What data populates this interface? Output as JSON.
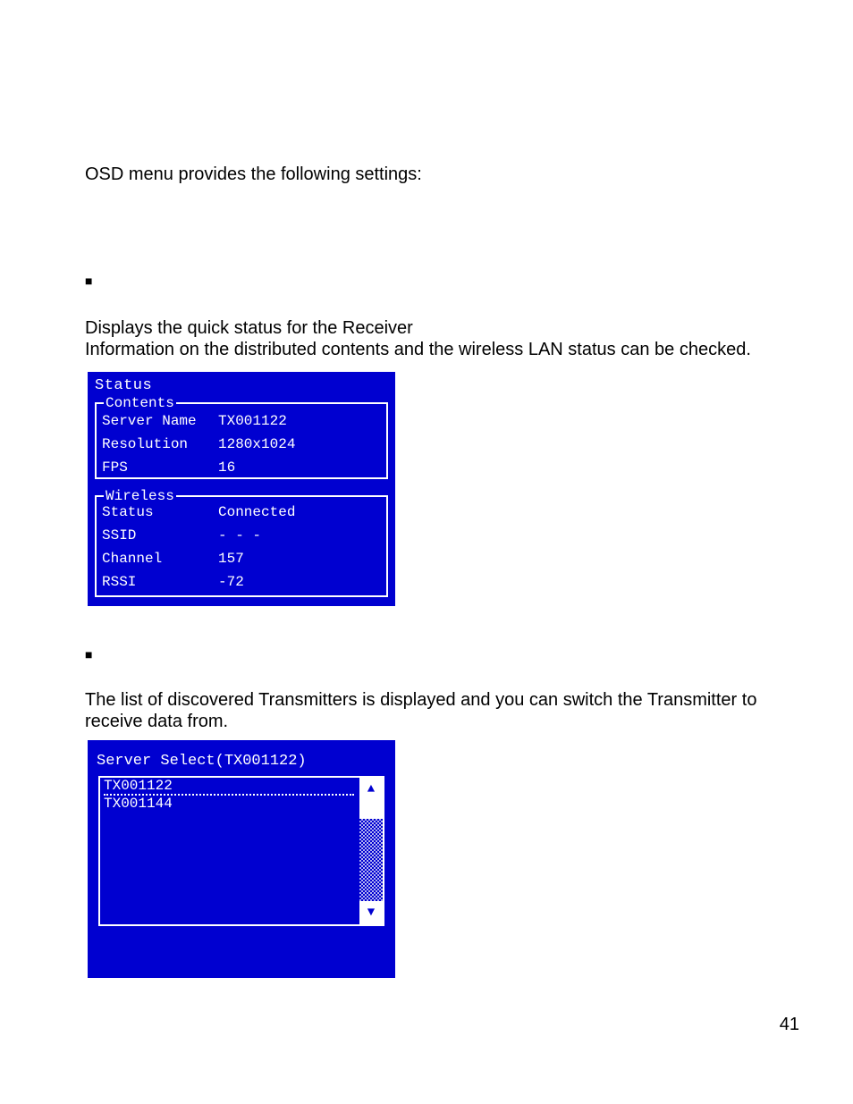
{
  "text": {
    "intro": "OSD menu provides the following settings:",
    "sec1_line1": "Displays the quick status for the Receiver",
    "sec1_line2": "Information on the distributed contents and the wireless LAN status can be checked.",
    "sec2_line1": "The list of discovered Transmitters is displayed and you can switch the Transmitter to",
    "sec2_line2": "receive data from.",
    "page_number": "41"
  },
  "status_panel": {
    "title": "Status",
    "contents": {
      "legend": "Contents",
      "rows": {
        "server_name": {
          "label": "Server Name",
          "value": "TX001122"
        },
        "resolution": {
          "label": "Resolution",
          "value": "1280x1024"
        },
        "fps": {
          "label": "FPS",
          "value": "16"
        }
      }
    },
    "wireless": {
      "legend": "Wireless",
      "rows": {
        "status": {
          "label": "Status",
          "value": "Connected"
        },
        "ssid": {
          "label": "SSID",
          "value": "- - -"
        },
        "channel": {
          "label": "Channel",
          "value": "157"
        },
        "rssi": {
          "label": "RSSI",
          "value": "-72"
        }
      }
    }
  },
  "server_select_panel": {
    "title": "Server Select(TX001122)",
    "items": [
      {
        "label": "TX001122",
        "selected": true
      },
      {
        "label": "TX001144",
        "selected": false
      }
    ]
  }
}
